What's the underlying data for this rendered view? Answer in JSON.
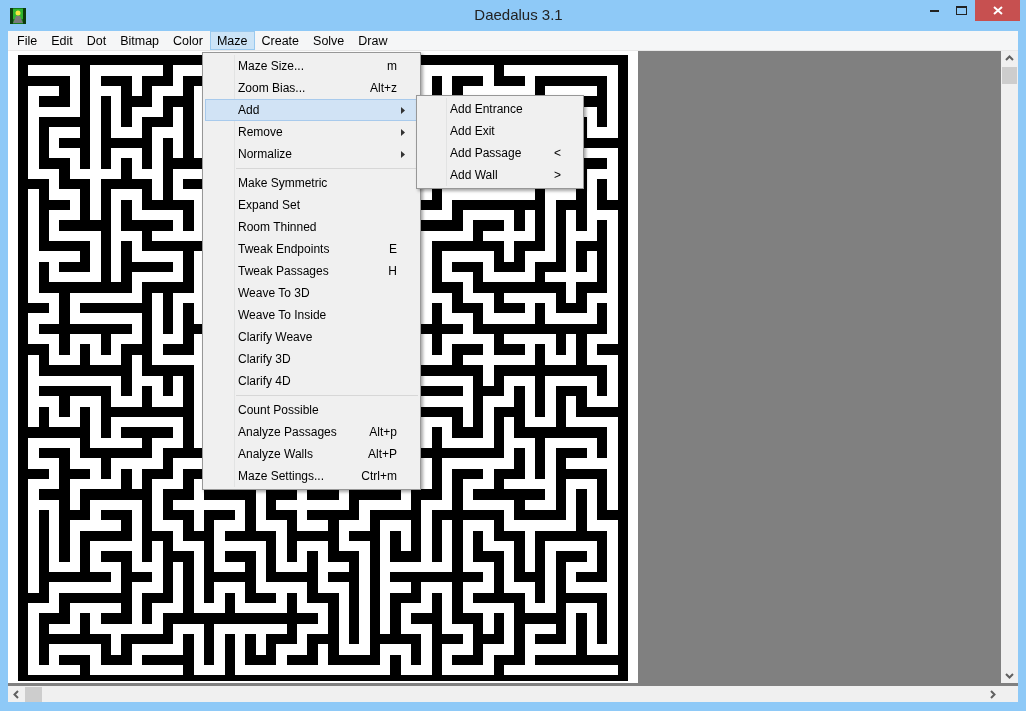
{
  "window": {
    "title": "Daedalus 3.1"
  },
  "menu_bar": [
    {
      "label": "File",
      "selected": false
    },
    {
      "label": "Edit",
      "selected": false
    },
    {
      "label": "Dot",
      "selected": false
    },
    {
      "label": "Bitmap",
      "selected": false
    },
    {
      "label": "Color",
      "selected": false
    },
    {
      "label": "Maze",
      "selected": true
    },
    {
      "label": "Create",
      "selected": false
    },
    {
      "label": "Solve",
      "selected": false
    },
    {
      "label": "Draw",
      "selected": false
    }
  ],
  "maze_menu": [
    {
      "kind": "item",
      "label": "Maze Size...",
      "shortcut": "m",
      "selected": false
    },
    {
      "kind": "item",
      "label": "Zoom Bias...",
      "shortcut": "Alt+z",
      "selected": false
    },
    {
      "kind": "submenu",
      "label": "Add",
      "selected": true
    },
    {
      "kind": "submenu",
      "label": "Remove",
      "selected": false
    },
    {
      "kind": "submenu",
      "label": "Normalize",
      "selected": false
    },
    {
      "kind": "separator"
    },
    {
      "kind": "item",
      "label": "Make Symmetric",
      "selected": false
    },
    {
      "kind": "item",
      "label": "Expand Set",
      "selected": false
    },
    {
      "kind": "item",
      "label": "Room Thinned",
      "selected": false
    },
    {
      "kind": "item",
      "label": "Tweak Endpoints",
      "shortcut": "E",
      "selected": false
    },
    {
      "kind": "item",
      "label": "Tweak Passages",
      "shortcut": "H",
      "selected": false
    },
    {
      "kind": "item",
      "label": "Weave To 3D",
      "selected": false
    },
    {
      "kind": "item",
      "label": "Weave To Inside",
      "selected": false
    },
    {
      "kind": "item",
      "label": "Clarify Weave",
      "selected": false
    },
    {
      "kind": "item",
      "label": "Clarify 3D",
      "selected": false
    },
    {
      "kind": "item",
      "label": "Clarify 4D",
      "selected": false
    },
    {
      "kind": "separator"
    },
    {
      "kind": "item",
      "label": "Count Possible",
      "selected": false
    },
    {
      "kind": "item",
      "label": "Analyze Passages",
      "shortcut": "Alt+p",
      "selected": false
    },
    {
      "kind": "item",
      "label": "Analyze Walls",
      "shortcut": "Alt+P",
      "selected": false
    },
    {
      "kind": "item",
      "label": "Maze Settings...",
      "shortcut": "Ctrl+m",
      "selected": false
    }
  ],
  "add_submenu": [
    {
      "label": "Add Entrance"
    },
    {
      "label": "Add Exit"
    },
    {
      "label": "Add Passage",
      "shortcut": "<"
    },
    {
      "label": "Add Wall",
      "shortcut": ">"
    }
  ]
}
